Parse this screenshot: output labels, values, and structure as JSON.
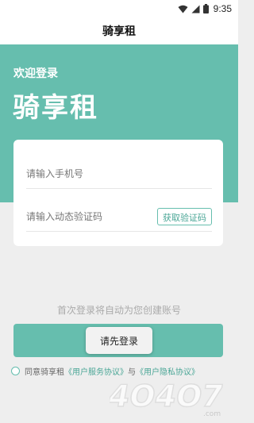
{
  "status_bar": {
    "time": "9:35"
  },
  "nav": {
    "title": "骑享租"
  },
  "hero": {
    "welcome": "欢迎登录",
    "brand": "骑享租"
  },
  "form": {
    "phone_placeholder": "请输入手机号",
    "code_placeholder": "请输入动态验证码",
    "get_code_label": "获取验证码"
  },
  "hint": "首次登录将自动为您创建账号",
  "toast": "请先登录",
  "agreement": {
    "prefix": "同意骑享租",
    "user_service": "《用户服务协议》",
    "connector": "与",
    "privacy": "《用户隐私协议》"
  },
  "watermark": {
    "text": "4O4O7.com"
  },
  "colors": {
    "accent": "#66beae",
    "link": "#4aa696"
  }
}
